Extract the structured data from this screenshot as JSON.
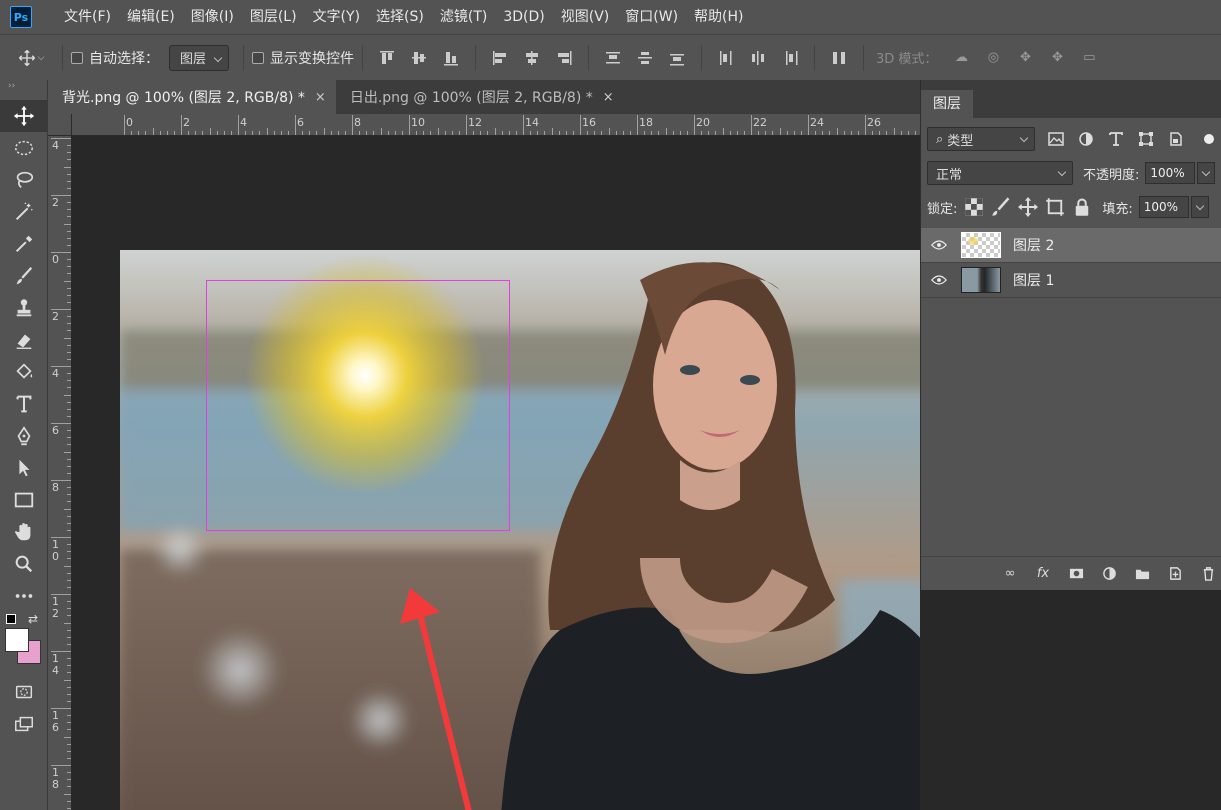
{
  "app": {
    "logo": "Ps",
    "menu": [
      "文件(F)",
      "编辑(E)",
      "图像(I)",
      "图层(L)",
      "文字(Y)",
      "选择(S)",
      "滤镜(T)",
      "3D(D)",
      "视图(V)",
      "窗口(W)",
      "帮助(H)"
    ]
  },
  "options": {
    "auto_select_label": "自动选择：",
    "auto_select_target": "图层",
    "show_transform_label": "显示变换控件",
    "mode3d_label": "3D 模式："
  },
  "tabs": [
    {
      "title": "背光.png @ 100% (图层 2, RGB/8) *",
      "close": "×"
    },
    {
      "title": "日出.png @ 100% (图层 2, RGB/8) *",
      "close": "×"
    }
  ],
  "ruler": {
    "top_labels": [
      "0",
      "2",
      "4",
      "6",
      "8",
      "10",
      "12",
      "14",
      "16",
      "18",
      "20",
      "22",
      "24",
      "26",
      "2"
    ],
    "left_labels": [
      "4",
      "2",
      "0",
      "2",
      "4",
      "6",
      "8",
      "10",
      "12",
      "14",
      "16",
      "18"
    ]
  },
  "layers_panel": {
    "tab_label": "图层",
    "filter_label": "类型",
    "blend_mode": "正常",
    "opacity_label": "不透明度:",
    "opacity_value": "100%",
    "lock_label": "锁定:",
    "fill_label": "填充:",
    "fill_value": "100%",
    "layers": [
      {
        "name": "图层 2",
        "selected": true
      },
      {
        "name": "图层 1",
        "selected": false
      }
    ],
    "fx_label": "fx"
  },
  "colors": {
    "selection": "#e040e0",
    "arrow": "#f23a3a",
    "foreground": "#ffffff",
    "background": "#e8a0cf"
  }
}
